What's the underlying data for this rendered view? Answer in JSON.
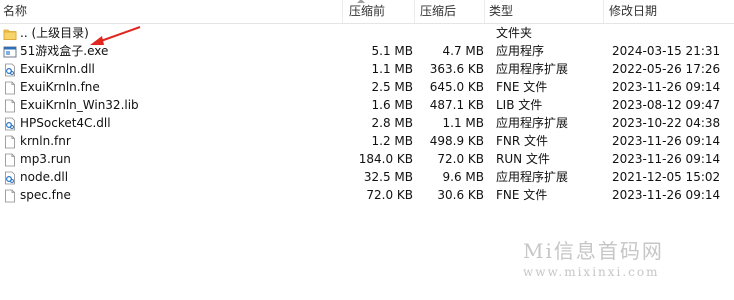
{
  "columns": {
    "name": "名称",
    "compressed_before": "压缩前",
    "compressed_after": "压缩后",
    "type": "类型",
    "modified": "修改日期"
  },
  "colors": {
    "folder": "#f4c74e",
    "folder_dark": "#d9a431",
    "annotation_arrow": "#e0261f",
    "watermark": "#c6c6c6"
  },
  "rows": [
    {
      "icon": "folder-icon",
      "name": ".. (上级目录)",
      "size_before": "",
      "size_after": "",
      "type": "文件夹",
      "modified": ""
    },
    {
      "icon": "exe-icon",
      "name": "51游戏盒子.exe",
      "size_before": "5.1 MB",
      "size_after": "4.7 MB",
      "type": "应用程序",
      "modified": "2024-03-15 21:31"
    },
    {
      "icon": "dll-icon",
      "name": "ExuiKrnln.dll",
      "size_before": "1.1 MB",
      "size_after": "363.6 KB",
      "type": "应用程序扩展",
      "modified": "2022-05-26 17:26"
    },
    {
      "icon": "file-icon",
      "name": "ExuiKrnln.fne",
      "size_before": "2.5 MB",
      "size_after": "645.0 KB",
      "type": "FNE 文件",
      "modified": "2023-11-26 09:14"
    },
    {
      "icon": "file-icon",
      "name": "ExuiKrnln_Win32.lib",
      "size_before": "1.6 MB",
      "size_after": "487.1 KB",
      "type": "LIB 文件",
      "modified": "2023-08-12 09:47"
    },
    {
      "icon": "dll-icon",
      "name": "HPSocket4C.dll",
      "size_before": "2.8 MB",
      "size_after": "1.1 MB",
      "type": "应用程序扩展",
      "modified": "2023-10-22 04:38"
    },
    {
      "icon": "file-icon",
      "name": "krnln.fnr",
      "size_before": "1.2 MB",
      "size_after": "498.9 KB",
      "type": "FNR 文件",
      "modified": "2023-11-26 09:14"
    },
    {
      "icon": "file-icon",
      "name": "mp3.run",
      "size_before": "184.0 KB",
      "size_after": "72.0 KB",
      "type": "RUN 文件",
      "modified": "2023-11-26 09:14"
    },
    {
      "icon": "dll-icon",
      "name": "node.dll",
      "size_before": "32.5 MB",
      "size_after": "9.6 MB",
      "type": "应用程序扩展",
      "modified": "2021-12-05 15:02"
    },
    {
      "icon": "file-icon",
      "name": "spec.fne",
      "size_before": "72.0 KB",
      "size_after": "30.6 KB",
      "type": "FNE 文件",
      "modified": "2023-11-26 09:14"
    }
  ],
  "watermark": {
    "title": "Mi信息首码网",
    "url": "www.mixinxi.com"
  }
}
